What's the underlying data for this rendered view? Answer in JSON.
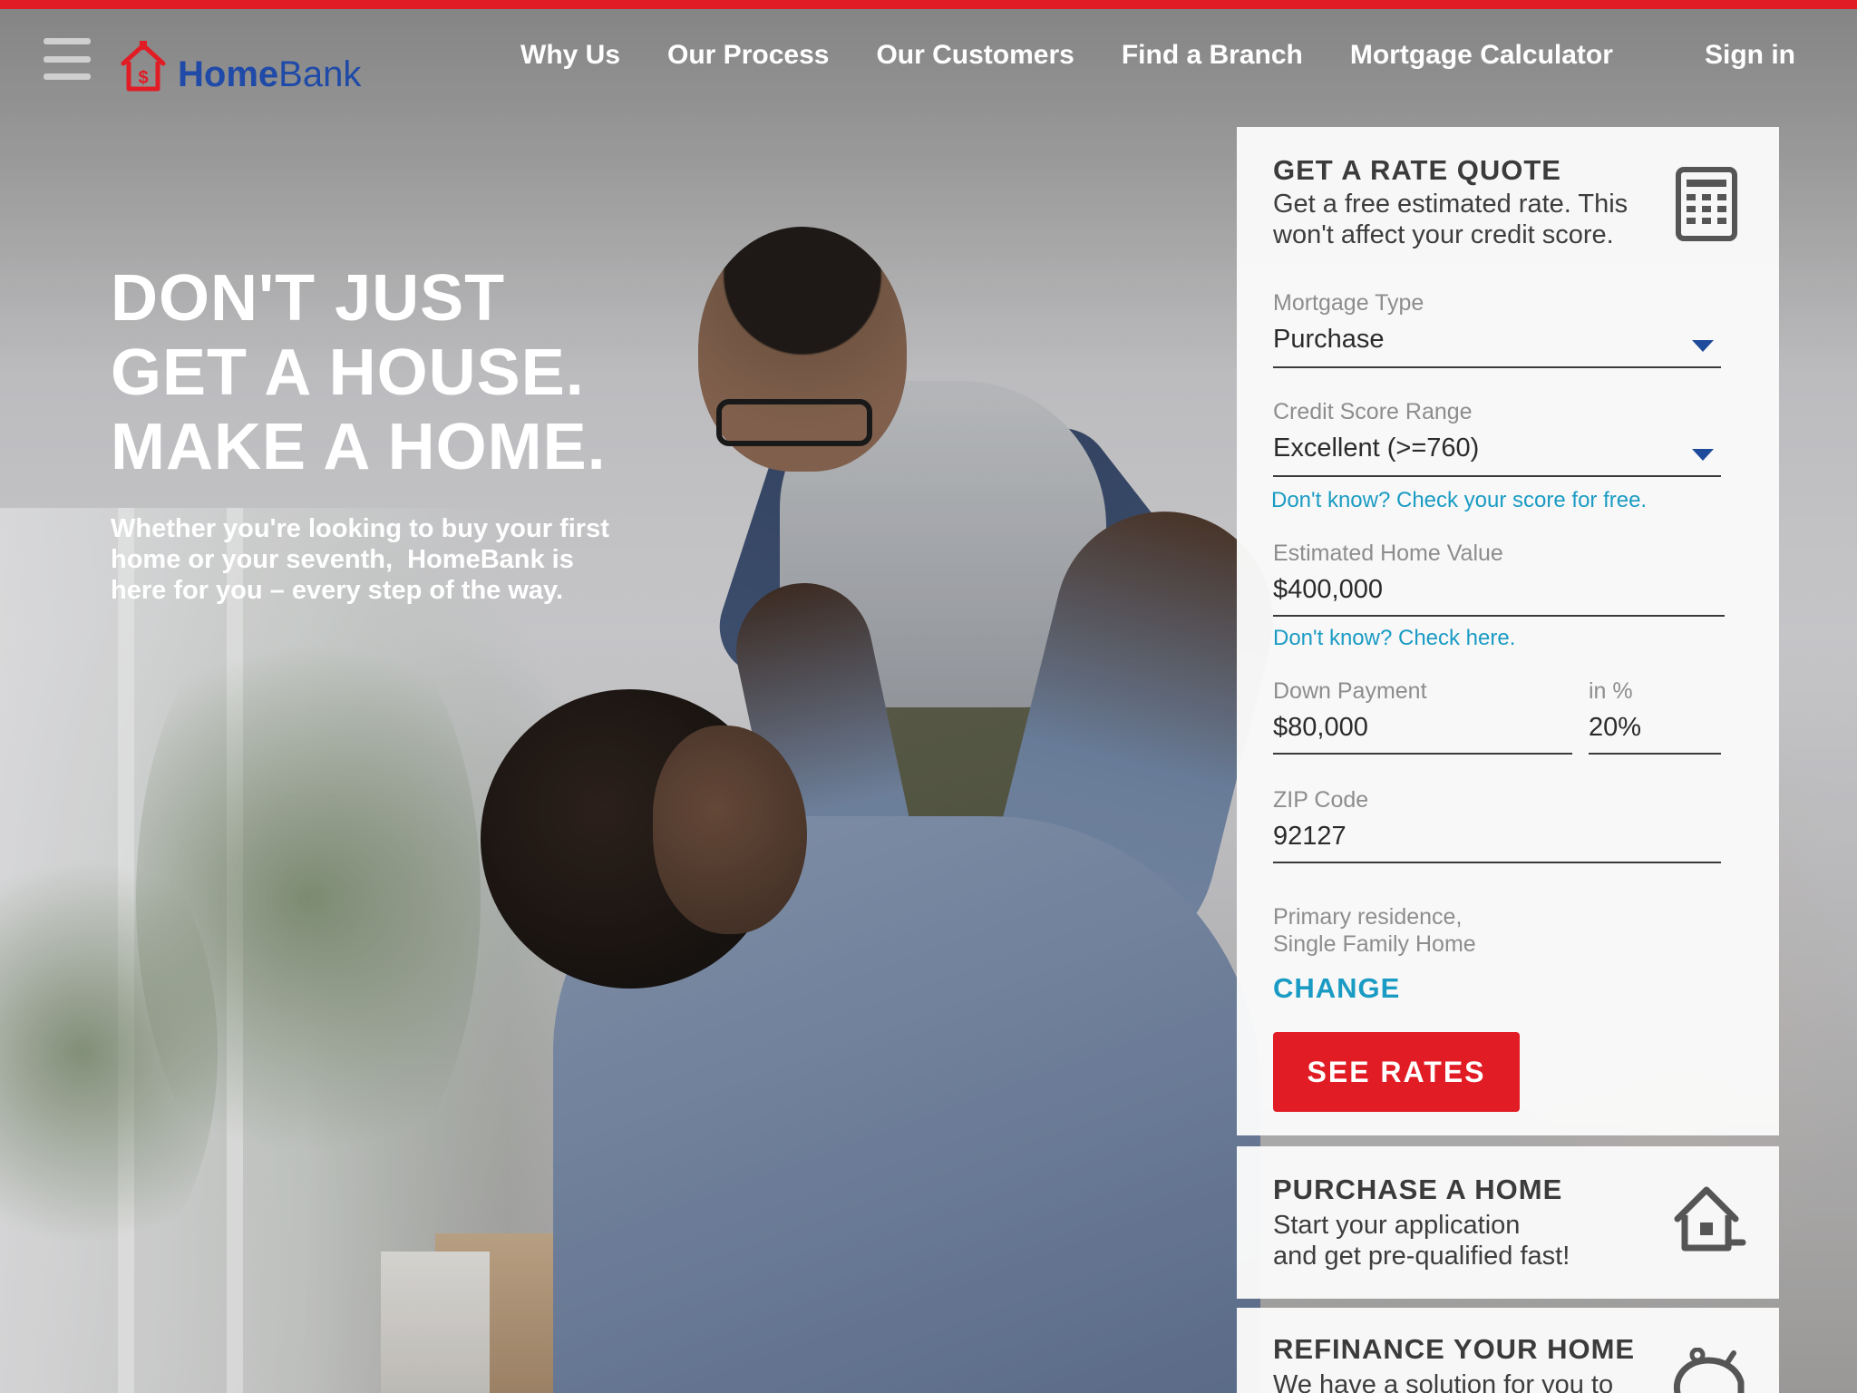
{
  "colors": {
    "brand_red": "#e21c24",
    "brand_blue": "#1f4aa8",
    "link_teal": "#1a9bc3",
    "caret_blue": "#1e4b9b"
  },
  "header": {
    "menu_icon": "hamburger-menu-icon",
    "logo": {
      "icon": "house-dollar-icon",
      "text_bold": "Home",
      "text_light": "Bank"
    },
    "nav": [
      "Why Us",
      "Our Process",
      "Our Customers",
      "Find a Branch",
      "Mortgage Calculator"
    ],
    "sign_in": "Sign in"
  },
  "hero": {
    "title_lines": [
      "DON'T JUST",
      "GET A HOUSE.",
      "MAKE A HOME."
    ],
    "subtitle_lines": [
      "Whether you're looking to buy your first",
      "home or your seventh,  HomeBank is",
      "here for you – every step of the way."
    ]
  },
  "rate_quote": {
    "title": "GET A RATE QUOTE",
    "description_lines": [
      "Get a free estimated rate. This",
      "won't affect your credit score."
    ],
    "icon": "calculator-icon",
    "mortgage_type": {
      "label": "Mortgage Type",
      "value": "Purchase"
    },
    "credit_score": {
      "label": "Credit Score Range",
      "value": "Excellent (>=760)",
      "help": "Don't know? Check your score for free."
    },
    "home_value": {
      "label": "Estimated Home Value",
      "value": "$400,000",
      "help": "Don't know? Check here."
    },
    "down_payment": {
      "label": "Down Payment",
      "value": "$80,000"
    },
    "down_percent": {
      "label": "in %",
      "value": "20%"
    },
    "zip": {
      "label": "ZIP Code",
      "value": "92127"
    },
    "residence_lines": [
      "Primary residence,",
      "Single Family Home"
    ],
    "change": "CHANGE",
    "see_rates": "SEE RATES"
  },
  "purchase": {
    "title": "PURCHASE A HOME",
    "description_lines": [
      "Start your application",
      "and get pre-qualified fast!"
    ],
    "icon": "house-icon"
  },
  "refinance": {
    "title": "REFINANCE YOUR HOME",
    "description_lines": [
      "We have a solution for you to"
    ],
    "icon": "piggy-bank-icon"
  }
}
